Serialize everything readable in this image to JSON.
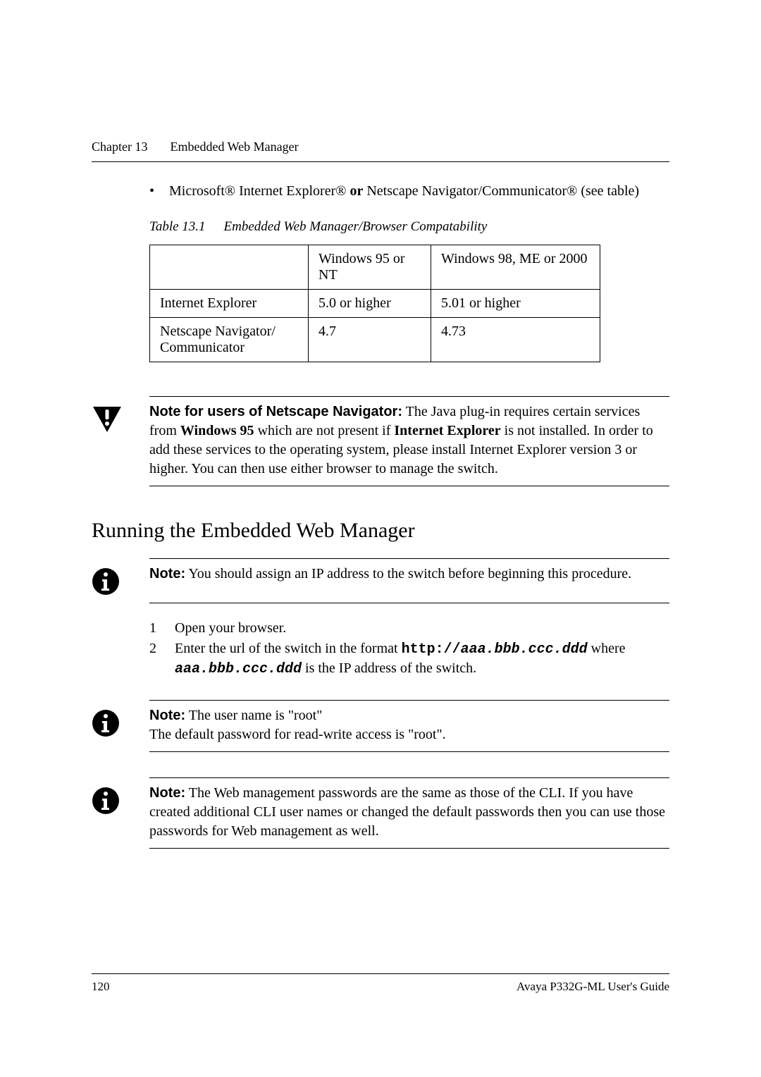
{
  "header": {
    "chapter": "Chapter 13",
    "title": "Embedded Web Manager"
  },
  "bullet": {
    "pre": "Microsoft® Internet Explorer® ",
    "or": "or",
    "post": " Netscape Navigator/Communicator® (see table)"
  },
  "table": {
    "caption_num": "Table 13.1",
    "caption_text": "Embedded Web Manager/Browser Compatability",
    "h1": "",
    "h2": "Windows 95 or NT",
    "h3": "Windows 98, ME or 2000",
    "r1c1": "Internet Explorer",
    "r1c2": "5.0 or higher",
    "r1c3": "5.01 or higher",
    "r2c1": "Netscape Navigator/ Communicator",
    "r2c2": "4.7",
    "r2c3": "4.73"
  },
  "warn_note": {
    "label": "Note for users of Netscape Navigator:",
    "t1": "  The Java plug-in requires certain services from ",
    "b1": "Windows 95",
    "t2": " which are not present if ",
    "b2": "Internet Explorer",
    "t3": " is not installed. In order to add these services to the operating system, please install Internet Explorer version 3 or higher. You can then use either browser to manage the switch."
  },
  "section_heading": "Running the Embedded Web Manager",
  "note1": {
    "label": "Note:",
    "text": "  You should assign an IP address to the switch before beginning this procedure."
  },
  "steps": {
    "n1": "1",
    "s1": "Open your browser.",
    "n2": "2",
    "s2a": "Enter the url of the switch in the format  ",
    "s2b": "http://",
    "s2c": "aaa.bbb.ccc.ddd",
    "s2d": "  where ",
    "s2e": "aaa.bbb.ccc.ddd",
    "s2f": "  is the IP address of the switch."
  },
  "note2": {
    "label": "Note:",
    "line1": "  The user name is \"root\"",
    "line2": "The default password for read-write access is \"root\"."
  },
  "note3": {
    "label": "Note:",
    "text": "  The Web management passwords are the same as those of the CLI. If you have created additional CLI user names or changed the default passwords then you can use those passwords for Web management as well."
  },
  "footer": {
    "page": "120",
    "guide": "Avaya P332G-ML User's Guide"
  }
}
